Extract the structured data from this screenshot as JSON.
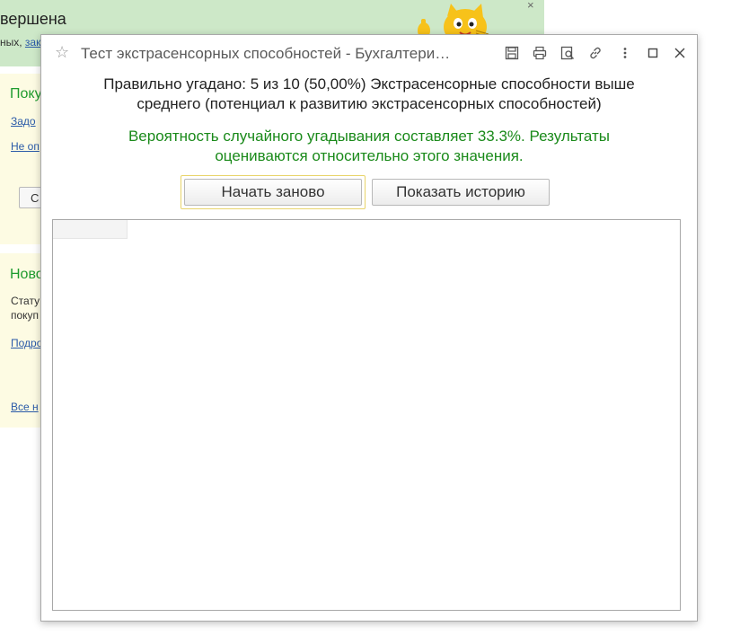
{
  "background": {
    "banner_title": "вершена",
    "banner_sub_text": "ных, ",
    "banner_sub_link": "зак",
    "banner_close": "×",
    "panel1_heading": "Поку",
    "panel1_link1": "Задо",
    "panel1_link2": "Не оп",
    "panel1_button": "С",
    "panel2_heading": "Ново",
    "panel2_text1": "Стату",
    "panel2_text2": "покуп",
    "panel2_link1": "Подро",
    "panel2_link2": "Все н"
  },
  "dialog": {
    "title": "Тест экстрасенсорных способностей - Бухгалтери…",
    "result_line1": "Правильно угадано: 5 из 10 (50,00%) Экстрасенсорные способности выше",
    "result_line2": "среднего (потенциал к развитию экстрасенсорных способностей)",
    "probability_line1": "Вероятность случайного угадывания составляет 33.3%. Результаты",
    "probability_line2": "оцениваются относительно этого значения.",
    "restart_button": "Начать заново",
    "history_button": "Показать историю",
    "toolbar_icons": [
      "save-icon",
      "print-icon",
      "preview-icon",
      "link-icon",
      "more-icon",
      "maximize-icon",
      "close-icon"
    ]
  },
  "colors": {
    "accent_green": "#1a8a1a",
    "banner_bg": "#cde8c8",
    "panel_bg": "#fdfbe3",
    "link_blue": "#2a5aa8",
    "focus_yellow": "#e8d46a"
  }
}
